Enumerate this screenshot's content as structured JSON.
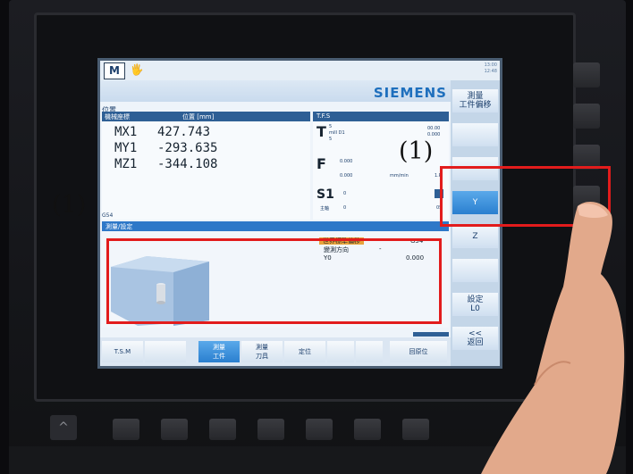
{
  "screen": {
    "mode_box": "M",
    "mode_icon": "🖐",
    "clock": "13:00\n12:48",
    "brand": "SIEMENS",
    "position_label": "位置",
    "coord_header": {
      "axis": "機械座標",
      "pos": "位置 [mm]",
      "tfs": "T.F.S"
    },
    "axes": [
      {
        "name": "MX1",
        "value": "427.743"
      },
      {
        "name": "MY1",
        "value": "-293.635"
      },
      {
        "name": "MZ1",
        "value": "-344.108"
      }
    ],
    "tfs": {
      "t_letter": "T",
      "t_info": [
        "5",
        "mill D1",
        "5"
      ],
      "t_right": [
        "00.00",
        "0.000"
      ],
      "f_letter": "F",
      "f_values": [
        "0.000",
        "0.000"
      ],
      "f_unit": "mm/min",
      "f_pct": "1.P",
      "s_letter": "S1",
      "s_value": "0",
      "s_main": "主軸",
      "s_val2": "0",
      "s_pct": "05"
    },
    "g_code": "G54",
    "workpiece_header": "測量/設定",
    "info": {
      "highlight": "世界標準偏移",
      "highlight_value": "G54",
      "direction_label": "變測方向",
      "direction_value": "-",
      "y0_label": "Y0",
      "y0_value": "0.000"
    },
    "softkeys": [
      "測量\n工件偏移",
      "",
      "",
      "Y",
      "Z",
      "",
      "設定\nL0",
      "<<\n返回"
    ],
    "bottom": [
      {
        "label": "T.S.M"
      },
      {
        "label": ""
      },
      {
        "label": "測量\n工件"
      },
      {
        "label": "測量\n刀具"
      },
      {
        "label": "定位"
      },
      {
        "label": ""
      },
      {
        "label": ""
      },
      {
        "label": "回原位"
      }
    ]
  },
  "annotations": [
    "(1)",
    "(1)"
  ],
  "hardware": {
    "caret": "^"
  },
  "colors": {
    "accent": "#2e78c8",
    "annotation": "#e21c1c",
    "brand": "#1e6fbd",
    "highlight": "#e8a33a"
  }
}
